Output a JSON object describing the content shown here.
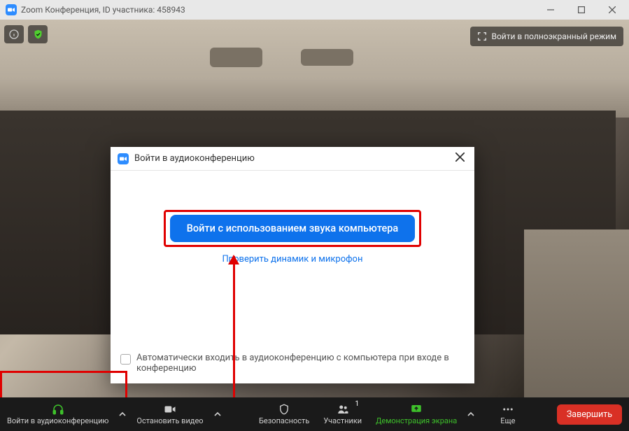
{
  "titlebar": {
    "title": "Zoom Конференция, ID участника: 458943"
  },
  "overlay": {
    "fullscreen_label": "Войти в полноэкранный режим"
  },
  "dialog": {
    "title": "Войти в аудиоконференцию",
    "primary_button": "Войти с использованием звука компьютера",
    "test_link": "Проверить динамик и микрофон",
    "checkbox_label": "Автоматически входить в аудиоконференцию с компьютера при входе в конференцию"
  },
  "bottom": {
    "audio": "Войти в аудиоконференцию",
    "video": "Остановить видео",
    "security": "Безопасность",
    "participants": "Участники",
    "participants_count": "1",
    "share": "Демонстрация экрана",
    "more": "Еще",
    "end": "Завершить"
  }
}
